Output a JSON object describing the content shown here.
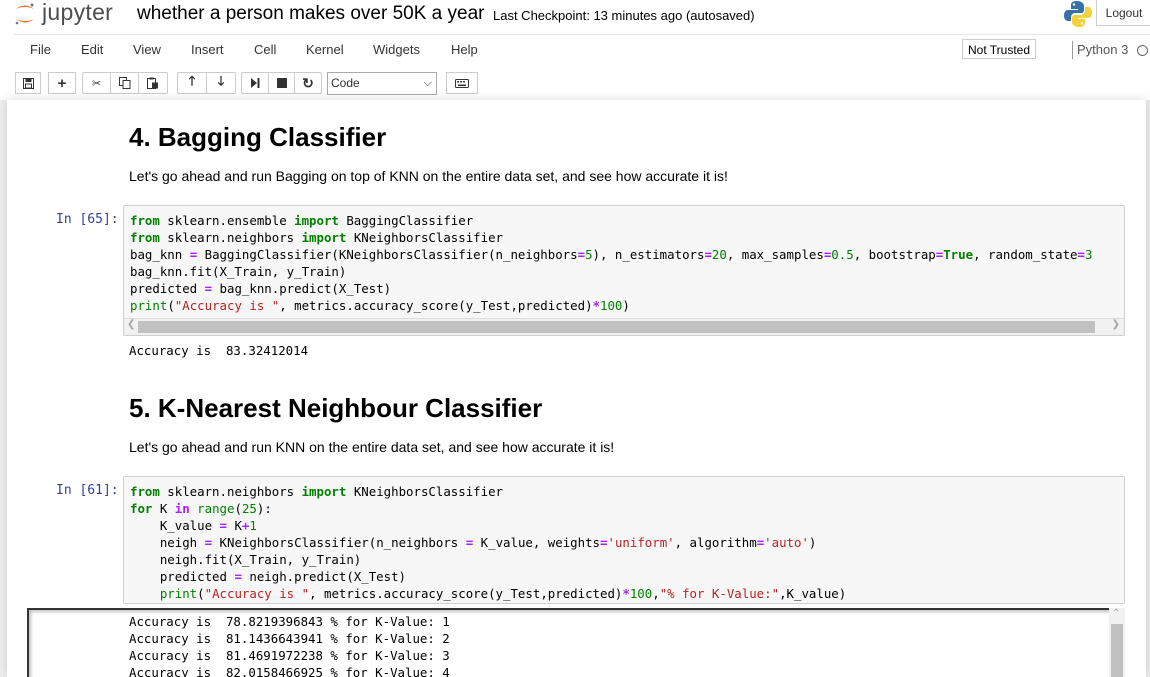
{
  "header": {
    "logo_text": "jupyter",
    "notebook_name": "whether a person makes over 50K a year",
    "checkpoint": "Last Checkpoint: 13 minutes ago (autosaved)",
    "logout_label": "Logout"
  },
  "menu": {
    "items": [
      "File",
      "Edit",
      "View",
      "Insert",
      "Cell",
      "Kernel",
      "Widgets",
      "Help"
    ],
    "trusted": "Not Trusted",
    "kernel": "Python 3"
  },
  "toolbar": {
    "cell_type": "Code"
  },
  "cells": {
    "bagging": {
      "heading": "4. Bagging Classifier",
      "description": "Let's go ahead and run Bagging on top of KNN on the entire data set, and see how accurate it is!",
      "prompt": "In [65]:",
      "code": [
        "from sklearn.ensemble import BaggingClassifier",
        "from sklearn.neighbors import KNeighborsClassifier",
        "bag_knn = BaggingClassifier(KNeighborsClassifier(n_neighbors=5), n_estimators=20, max_samples=0.5, bootstrap=True, random_state=3",
        "bag_knn.fit(X_Train, y_Train)",
        "predicted = bag_knn.predict(X_Test)",
        "print(\"Accuracy is \", metrics.accuracy_score(y_Test,predicted)*100)"
      ],
      "output": "Accuracy is  83.32412014"
    },
    "knn": {
      "heading": "5. K-Nearest Neighbour Classifier",
      "description": "Let's go ahead and run KNN on the entire data set, and see how accurate it is!",
      "prompt": "In [61]:",
      "code": [
        "from sklearn.neighbors import KNeighborsClassifier",
        "for K in range(25):",
        "    K_value = K+1",
        "    neigh = KNeighborsClassifier(n_neighbors = K_value, weights='uniform', algorithm='auto')",
        "    neigh.fit(X_Train, y_Train)",
        "    predicted = neigh.predict(X_Test)",
        "    print(\"Accuracy is \", metrics.accuracy_score(y_Test,predicted)*100,\"% for K-Value:\",K_value)"
      ],
      "output": [
        "Accuracy is  78.8219396843 % for K-Value: 1",
        "Accuracy is  81.1436643941 % for K-Value: 2",
        "Accuracy is  81.4691972238 % for K-Value: 3",
        "Accuracy is  82.0158466925 % for K-Value: 4"
      ]
    }
  }
}
